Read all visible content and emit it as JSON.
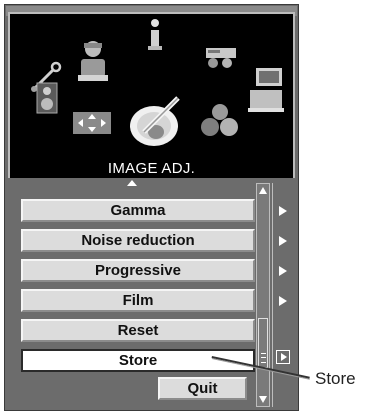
{
  "panel": {
    "caption": "IMAGE ADJ."
  },
  "menu": {
    "items": [
      {
        "label": "Gamma",
        "has_submenu": true
      },
      {
        "label": "Noise reduction",
        "has_submenu": true
      },
      {
        "label": "Progressive",
        "has_submenu": true
      },
      {
        "label": "Film",
        "has_submenu": true
      },
      {
        "label": "Reset",
        "has_submenu": false
      },
      {
        "label": "Store",
        "has_submenu": false,
        "selected": true
      }
    ],
    "quit_label": "Quit"
  },
  "callout": {
    "label": "Store"
  },
  "icons": [
    "wrench-icon",
    "person-icon",
    "info-icon",
    "projector-icon",
    "speaker-icon",
    "arrows-icon",
    "image-adjust-icon",
    "balls-icon",
    "laptop-icon"
  ]
}
